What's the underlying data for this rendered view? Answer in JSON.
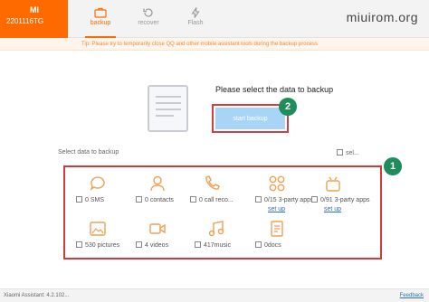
{
  "device": {
    "logo": "MI",
    "name": "2201116TG"
  },
  "tabs": [
    {
      "label": "backup",
      "icon": "briefcase-icon",
      "active": true
    },
    {
      "label": "recover",
      "icon": "recover-icon",
      "active": false
    },
    {
      "label": "Flash",
      "icon": "flash-icon",
      "active": false
    }
  ],
  "brand": "miuirom.org",
  "tip": "Tip: Please try to temporarily close QQ and other mobile assistant tools during the backup process",
  "main": {
    "title": "Please select the data to backup",
    "start_button": "start backup",
    "select_data_label": "Select data to backup",
    "select_all_label": "sel..."
  },
  "markers": {
    "one": "1",
    "two": "2"
  },
  "items": [
    {
      "label": "0 SMS",
      "icon": "sms-icon"
    },
    {
      "label": "0 contacts",
      "icon": "contacts-icon"
    },
    {
      "label": "0 call reco...",
      "icon": "phone-icon"
    },
    {
      "label": "0/15 3-party apps",
      "icon": "apps-icon",
      "setup": "set up"
    },
    {
      "label": "0/91 3-party apps",
      "icon": "android-icon",
      "setup": "set up"
    },
    {
      "label": "530 pictures",
      "icon": "picture-icon"
    },
    {
      "label": "4 videos",
      "icon": "video-icon"
    },
    {
      "label": "417music",
      "icon": "music-icon"
    },
    {
      "label": "0docs",
      "icon": "docs-icon"
    }
  ],
  "status": {
    "version": "Xiaomi Assistant: 4.2.102...",
    "feedback": "Feedback"
  },
  "colors": {
    "accent": "#ff6a00",
    "highlight_box": "#cf3a3a",
    "marker": "#1f8c5b",
    "button": "#a8d4f5",
    "tip_text": "#f08a3a",
    "link": "#2f6fbf"
  }
}
